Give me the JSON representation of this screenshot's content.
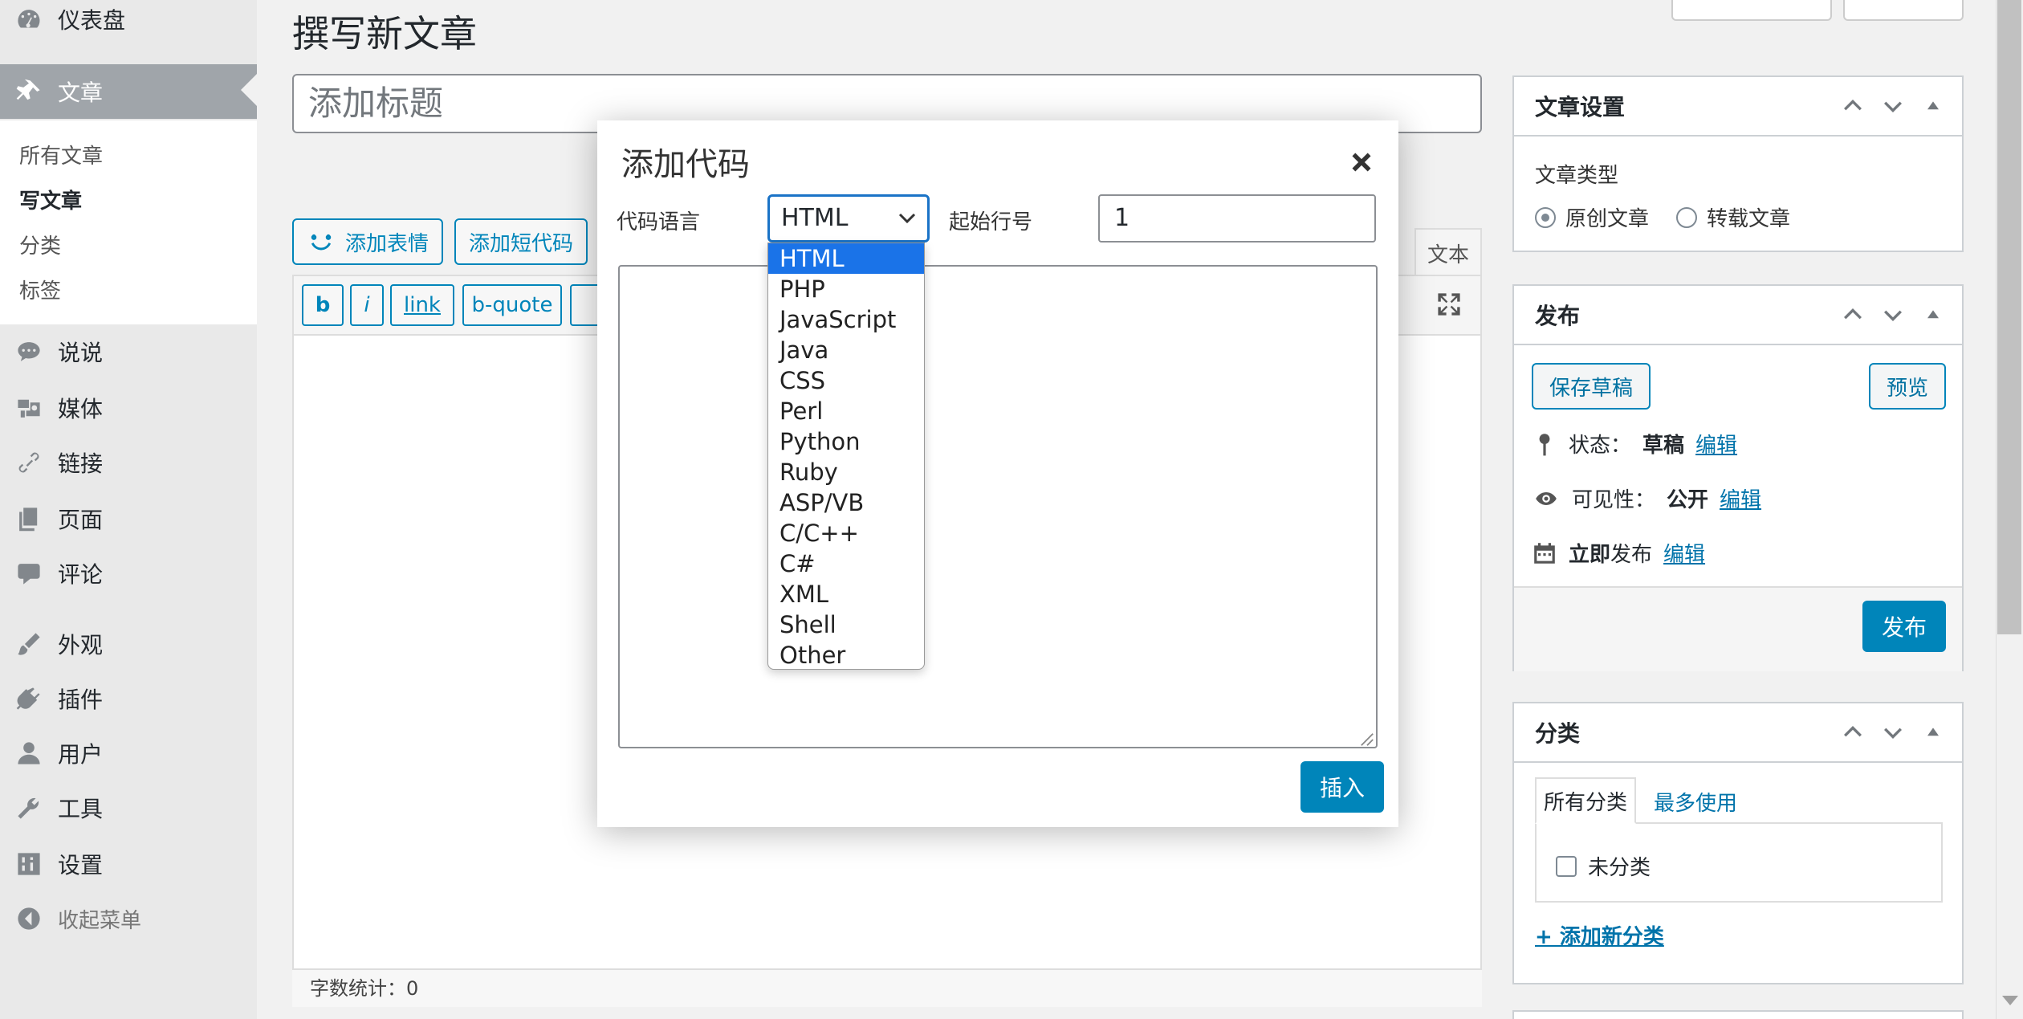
{
  "sidebar": {
    "items": [
      {
        "label": "仪表盘",
        "icon": "dashboard-icon"
      },
      {
        "label": "文章",
        "icon": "pin-icon"
      },
      {
        "label": "说说",
        "icon": "chat-icon"
      },
      {
        "label": "媒体",
        "icon": "media-icon"
      },
      {
        "label": "链接",
        "icon": "link-icon"
      },
      {
        "label": "页面",
        "icon": "page-icon"
      },
      {
        "label": "评论",
        "icon": "comment-icon"
      },
      {
        "label": "外观",
        "icon": "brush-icon"
      },
      {
        "label": "插件",
        "icon": "plugin-icon"
      },
      {
        "label": "用户",
        "icon": "user-icon"
      },
      {
        "label": "工具",
        "icon": "wrench-icon"
      },
      {
        "label": "设置",
        "icon": "settings-icon"
      }
    ],
    "submenu": [
      "所有文章",
      "写文章",
      "分类",
      "标签"
    ],
    "collapse": "收起菜单"
  },
  "page": {
    "title": "撰写新文章",
    "title_placeholder": "添加标题"
  },
  "editor": {
    "add_emoji": "添加表情",
    "add_shortcode": "添加短代码",
    "tag_buttons": [
      "b",
      "i",
      "link",
      "b-quote"
    ],
    "text_tab": "文本",
    "word_count": "字数统计：0"
  },
  "post_settings": {
    "title": "文章设置",
    "type_label": "文章类型",
    "original": "原创文章",
    "reprint": "转载文章"
  },
  "publish": {
    "title": "发布",
    "save_draft": "保存草稿",
    "preview": "预览",
    "status_label": "状态：",
    "status_value": "草稿",
    "visibility_label": "可见性：",
    "visibility_value": "公开",
    "schedule_bold": "立即",
    "schedule_text": "发布",
    "edit": "编辑",
    "publish_button": "发布"
  },
  "categories": {
    "title": "分类",
    "tab_all": "所有分类",
    "tab_popular": "最多使用",
    "uncategorized": "未分类",
    "add_new": "+ 添加新分类"
  },
  "modal": {
    "title": "添加代码",
    "language_label": "代码语言",
    "selected_language": "HTML",
    "start_line_label": "起始行号",
    "start_line_value": "1",
    "insert": "插入",
    "options": [
      "HTML",
      "PHP",
      "JavaScript",
      "Java",
      "CSS",
      "Perl",
      "Python",
      "Ruby",
      "ASP/VB",
      "C/C++",
      "C#",
      "XML",
      "Shell",
      "Other"
    ]
  },
  "colors": {
    "accent": "#0085ba",
    "select_highlight": "#1a73e8"
  }
}
